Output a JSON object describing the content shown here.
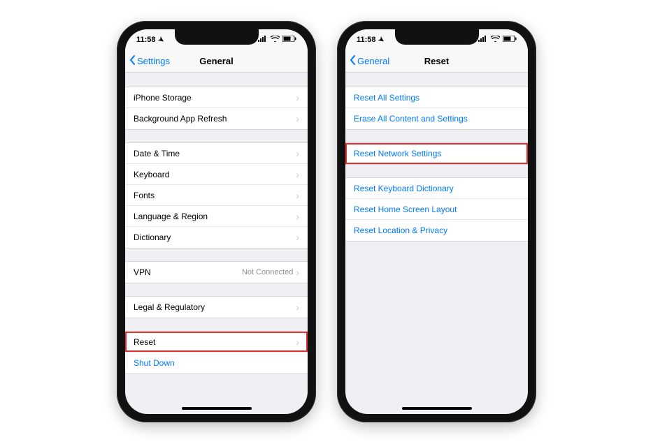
{
  "status": {
    "time": "11:58"
  },
  "phoneA": {
    "back": "Settings",
    "title": "General",
    "groups": [
      [
        {
          "label": "iPhone Storage",
          "chevron": true
        },
        {
          "label": "Background App Refresh",
          "chevron": true
        }
      ],
      [
        {
          "label": "Date & Time",
          "chevron": true
        },
        {
          "label": "Keyboard",
          "chevron": true
        },
        {
          "label": "Fonts",
          "chevron": true
        },
        {
          "label": "Language & Region",
          "chevron": true
        },
        {
          "label": "Dictionary",
          "chevron": true
        }
      ],
      [
        {
          "label": "VPN",
          "detail": "Not Connected",
          "chevron": true
        }
      ],
      [
        {
          "label": "Legal & Regulatory",
          "chevron": true
        }
      ],
      [
        {
          "label": "Reset",
          "chevron": true,
          "highlight": true
        },
        {
          "label": "Shut Down",
          "blue": true
        }
      ]
    ]
  },
  "phoneB": {
    "back": "General",
    "title": "Reset",
    "groups": [
      [
        {
          "label": "Reset All Settings",
          "blue": true
        },
        {
          "label": "Erase All Content and Settings",
          "blue": true
        }
      ],
      [
        {
          "label": "Reset Network Settings",
          "blue": true,
          "highlight": true
        }
      ],
      [
        {
          "label": "Reset Keyboard Dictionary",
          "blue": true
        },
        {
          "label": "Reset Home Screen Layout",
          "blue": true
        },
        {
          "label": "Reset Location & Privacy",
          "blue": true
        }
      ]
    ]
  }
}
